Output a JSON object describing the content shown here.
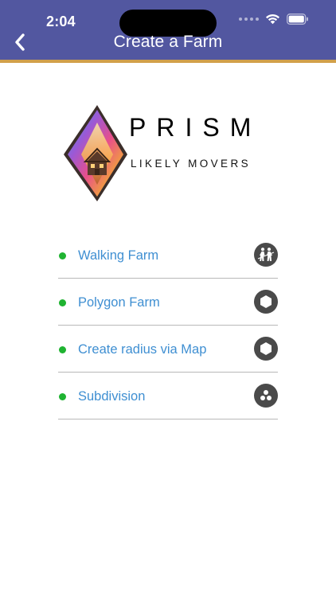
{
  "status_bar": {
    "time": "2:04"
  },
  "header": {
    "title": "Create a Farm",
    "back_icon": "chevron-left-icon"
  },
  "logo": {
    "brand": "PRISM",
    "tagline": "LIKELY MOVERS"
  },
  "farm_types": [
    {
      "label": "Walking Farm",
      "icon": "walking-people-icon"
    },
    {
      "label": "Polygon Farm",
      "icon": "hexagon-icon"
    },
    {
      "label": "Create radius via Map",
      "icon": "hexagon-icon"
    },
    {
      "label": "Subdivision",
      "icon": "dots-cluster-icon"
    }
  ],
  "colors": {
    "header_bg": "#5257a0",
    "header_border": "#d2a04a",
    "link": "#3f8fd2",
    "bullet": "#1fb331",
    "icon_bg": "#4a4a4a"
  }
}
